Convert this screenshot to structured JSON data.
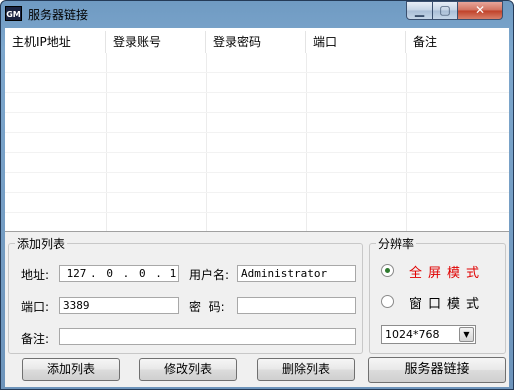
{
  "window": {
    "title": "服务器链接",
    "icon_text": "GM"
  },
  "grid": {
    "columns": [
      "主机IP地址",
      "登录账号",
      "登录密码",
      "端口",
      "备注"
    ]
  },
  "add_group": {
    "legend": "添加列表",
    "address_label": "地址:",
    "ip": [
      "127",
      "0",
      "0",
      "1"
    ],
    "username_label": "用户名:",
    "username_value": "Administrator",
    "port_label": "端口:",
    "port_value": "3389",
    "password_label": "密  码:",
    "password_value": "",
    "note_label": "备注:",
    "note_value": ""
  },
  "buttons": {
    "add": "添加列表",
    "edit": "修改列表",
    "delete": "删除列表",
    "connect": "服务器链接"
  },
  "resolution_group": {
    "legend": "分辨率",
    "fullscreen_label": "全屏模式",
    "windowed_label": "窗口模式",
    "selected_mode": "fullscreen",
    "fullscreen_color": "#e00000",
    "resolution_value": "1024*768"
  }
}
